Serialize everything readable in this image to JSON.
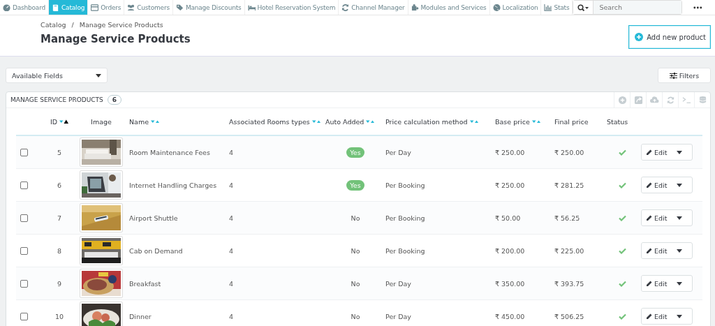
{
  "nav": [
    {
      "label": "Dashboard",
      "selected": false
    },
    {
      "label": "Catalog",
      "selected": true
    },
    {
      "label": "Orders",
      "selected": false
    },
    {
      "label": "Customers",
      "selected": false
    },
    {
      "label": "Manage Discounts",
      "selected": false
    },
    {
      "label": "Hotel Reservation System",
      "selected": false
    },
    {
      "label": "Channel Manager",
      "selected": false
    },
    {
      "label": "Modules and Services",
      "selected": false
    },
    {
      "label": "Localization",
      "selected": false
    },
    {
      "label": "Stats",
      "selected": false
    }
  ],
  "search": {
    "placeholder": "Search"
  },
  "breadcrumb": {
    "items": [
      "Catalog",
      "Manage Service Products"
    ],
    "separator": "/"
  },
  "page_title": "Manage Service Products",
  "add_button": "Add new product",
  "fields_dropdown": "Available Fields",
  "filters_button": "Filters",
  "panel": {
    "title": "MANAGE SERVICE PRODUCTS",
    "count": "6"
  },
  "columns": [
    {
      "label": "ID",
      "sortable": true,
      "sorted": true
    },
    {
      "label": "Image",
      "sortable": false,
      "sorted": false
    },
    {
      "label": "Name",
      "sortable": true,
      "sorted": false
    },
    {
      "label": "Associated Rooms types",
      "sortable": true,
      "sorted": false
    },
    {
      "label": "Auto Added",
      "sortable": true,
      "sorted": false
    },
    {
      "label": "Price calculation method",
      "sortable": true,
      "sorted": false
    },
    {
      "label": "Base price",
      "sortable": true,
      "sorted": false
    },
    {
      "label": "Final price",
      "sortable": false,
      "sorted": false
    },
    {
      "label": "Status",
      "sortable": false,
      "sorted": false
    }
  ],
  "rows": [
    {
      "checked": false,
      "id": "5",
      "name": "Room Maintenance Fees",
      "rooms": "4",
      "auto_added": true,
      "auto_label": "Yes",
      "method": "Per Day",
      "base": "₹ 250.00",
      "final": "₹ 250.00",
      "active": true,
      "action": "Edit"
    },
    {
      "checked": false,
      "id": "6",
      "name": "Internet Handling Charges",
      "rooms": "4",
      "auto_added": true,
      "auto_label": "Yes",
      "method": "Per Booking",
      "base": "₹ 250.00",
      "final": "₹ 281.25",
      "active": true,
      "action": "Edit"
    },
    {
      "checked": false,
      "id": "7",
      "name": "Airport Shuttle",
      "rooms": "4",
      "auto_added": false,
      "auto_label": "No",
      "method": "Per Booking",
      "base": "₹ 50.00",
      "final": "₹ 56.25",
      "active": true,
      "action": "Edit"
    },
    {
      "checked": false,
      "id": "8",
      "name": "Cab on Demand",
      "rooms": "4",
      "auto_added": false,
      "auto_label": "No",
      "method": "Per Booking",
      "base": "₹ 200.00",
      "final": "₹ 225.00",
      "active": true,
      "action": "Edit"
    },
    {
      "checked": false,
      "id": "9",
      "name": "Breakfast",
      "rooms": "4",
      "auto_added": false,
      "auto_label": "No",
      "method": "Per Day",
      "base": "₹ 350.00",
      "final": "₹ 393.75",
      "active": true,
      "action": "Edit"
    },
    {
      "checked": false,
      "id": "10",
      "name": "Dinner",
      "rooms": "4",
      "auto_added": false,
      "auto_label": "No",
      "method": "Per Day",
      "base": "₹ 450.00",
      "final": "₹ 506.25",
      "active": true,
      "action": "Edit"
    }
  ]
}
